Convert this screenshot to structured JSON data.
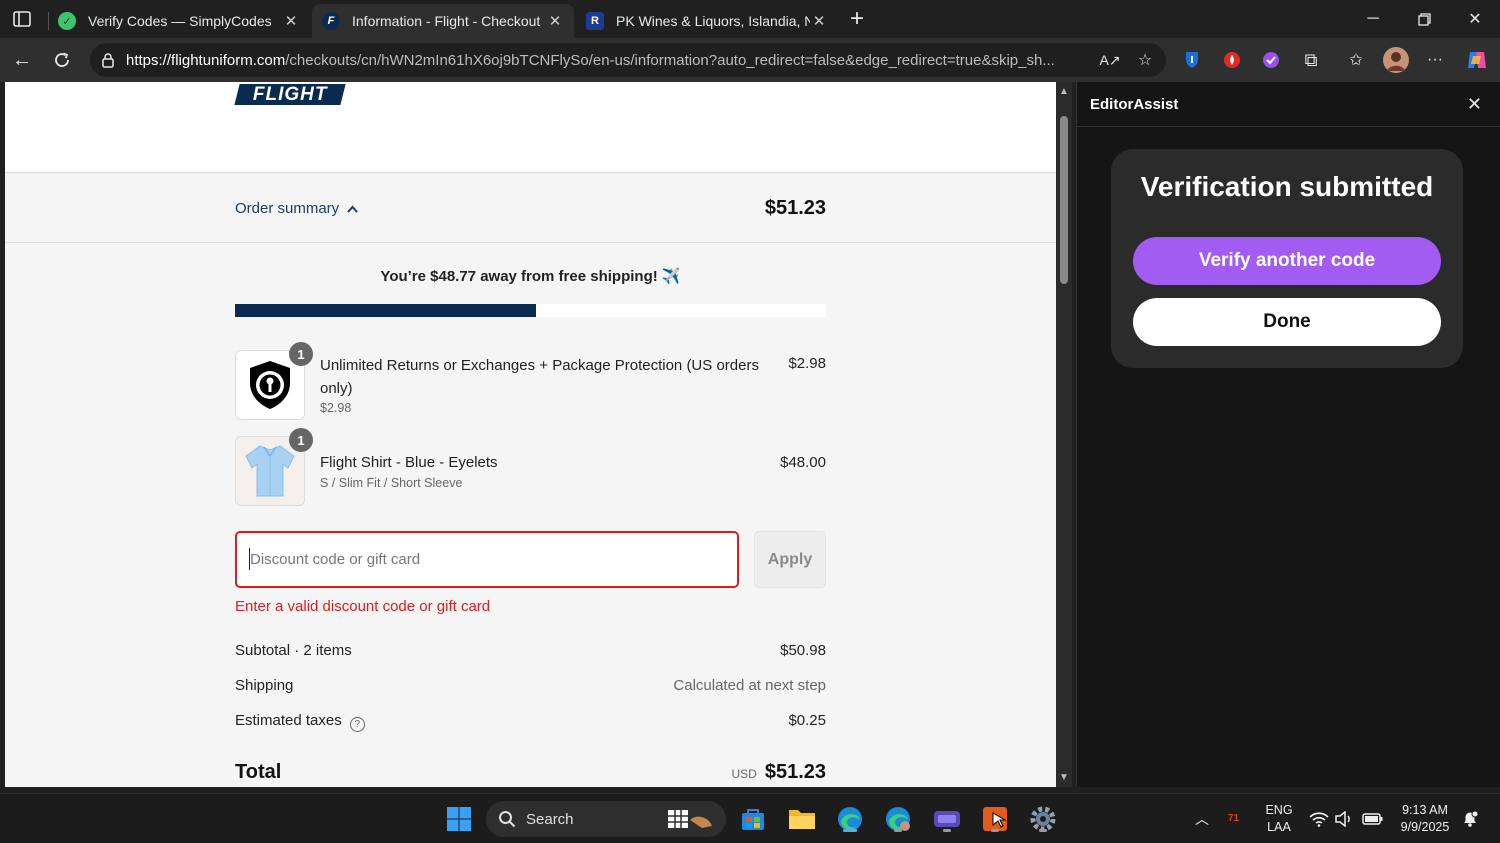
{
  "browser": {
    "tabs": [
      {
        "title": "Verify Codes — SimplyCodes",
        "active": false
      },
      {
        "title": "Information - Flight - Checkout",
        "active": true
      },
      {
        "title": "PK Wines & Liquors, Islandia, NY,",
        "active": false
      }
    ],
    "url_host": "https://flightuniform.com",
    "url_path": "/checkouts/cn/hWN2mIn61hX6oj9bTCNFlySo/en-us/information?auto_redirect=false&edge_redirect=true&skip_sh..."
  },
  "checkout": {
    "logo_text": "FLIGHT",
    "order_summary_label": "Order summary",
    "order_total": "$51.23",
    "free_shipping_message": "You’re $48.77 away from free shipping! ✈️",
    "free_shipping_progress": 0.51,
    "items": [
      {
        "qty": "1",
        "name": "Unlimited Returns or Exchanges + Package Protection (US orders only)",
        "sub": "$2.98",
        "price": "$2.98"
      },
      {
        "qty": "1",
        "name": "Flight Shirt - Blue - Eyelets",
        "sub": "S / Slim Fit / Short Sleeve",
        "price": "$48.00"
      }
    ],
    "discount_placeholder": "Discount code or gift card",
    "apply_label": "Apply",
    "discount_error": "Enter a valid discount code or gift card",
    "subtotal_label": "Subtotal · 2 items",
    "subtotal_value": "$50.98",
    "shipping_label": "Shipping",
    "shipping_value": "Calculated at next step",
    "taxes_label": "Estimated taxes",
    "taxes_value": "$0.25",
    "total_label": "Total",
    "total_currency": "USD",
    "total_value": "$51.23"
  },
  "sidepanel": {
    "title": "EditorAssist",
    "heading": "Verification submitted",
    "verify_another_label": "Verify another code",
    "done_label": "Done"
  },
  "taskbar": {
    "search_label": "Search",
    "lang_line1": "ENG",
    "lang_line2": "LAA",
    "time": "9:13 AM",
    "date": "9/9/2025",
    "badge": "71"
  },
  "colors": {
    "accent_purple": "#a25cf2",
    "brand_navy": "#0b2a4f",
    "error_red": "#dd1d1d"
  }
}
